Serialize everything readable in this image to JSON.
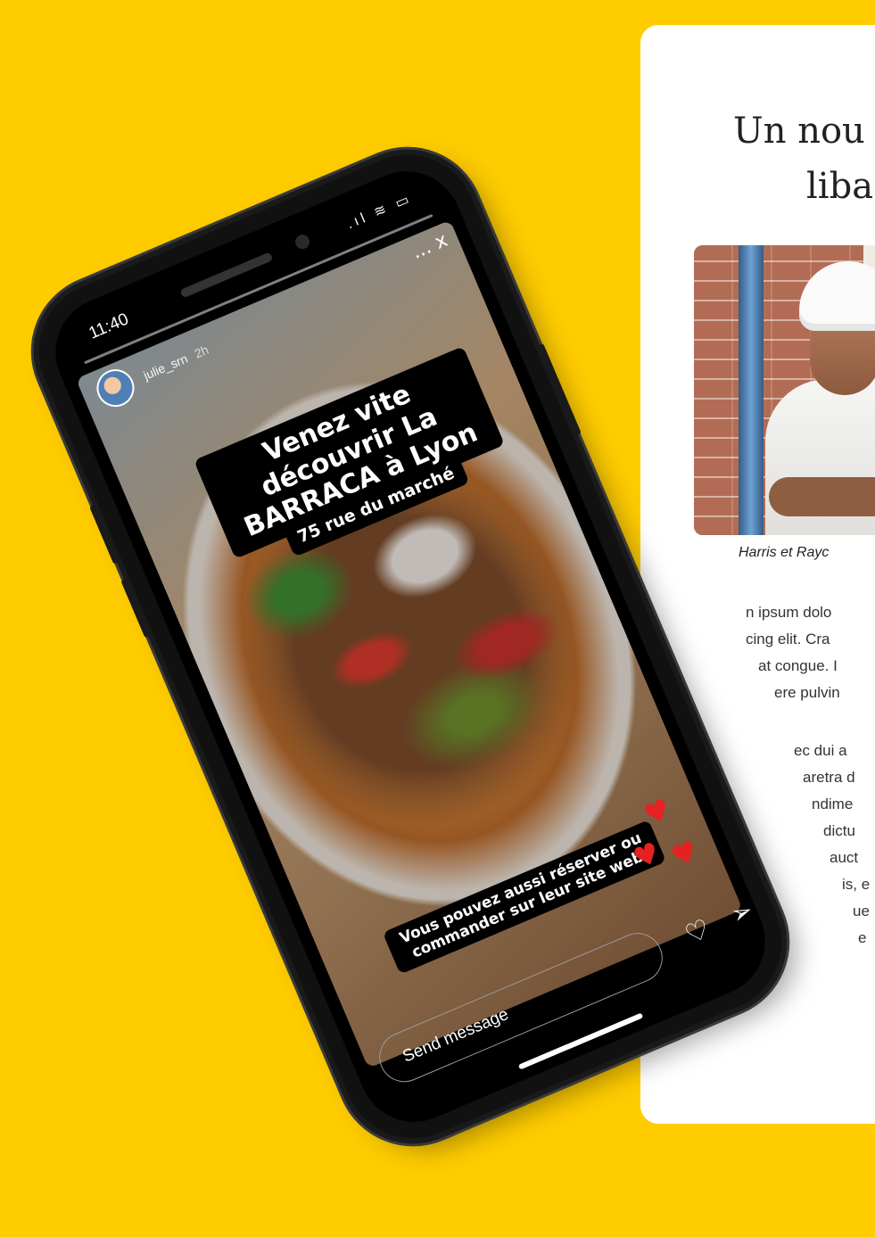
{
  "article": {
    "title_line1": "Un nou",
    "title_line2": "liba",
    "caption": "Harris et Rayc",
    "paragraph1": [
      "n ipsum dolo",
      "cing elit. Cra",
      "at congue. I",
      "ere pulvin"
    ],
    "paragraph2": [
      "ec dui a",
      "aretra d",
      "ndime",
      "dictu",
      "auct",
      "is, e",
      "ue",
      "e"
    ]
  },
  "phone": {
    "status_time": "11:40",
    "status_icons": ".ıl ≋ ▭",
    "story_user": "julie_srn",
    "story_age": "2h",
    "close_label": "...  x",
    "sticker_main": "Venez vite découvrir La BARRACA à Lyon",
    "sticker_address": "75 rue du marché",
    "sticker_bottom": "Vous pouvez aussi réserver ou commander sur leur site web",
    "message_placeholder": "Send message",
    "heart_glyph": "♥",
    "like_glyph": "♡",
    "send_glyph": "➢"
  },
  "colors": {
    "background": "#FFCC00",
    "heart": "#E52222"
  }
}
